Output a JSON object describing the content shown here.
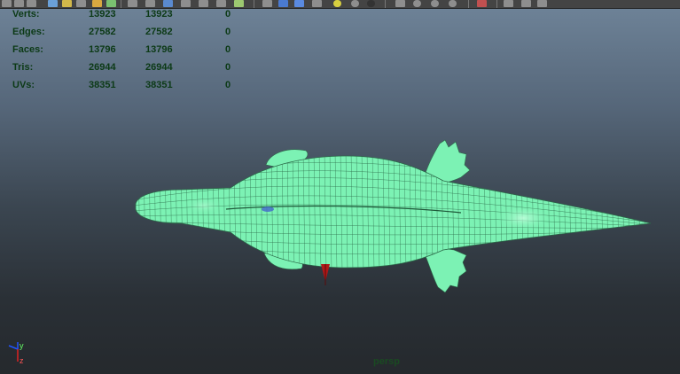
{
  "toolbar": {
    "icons": [
      "select-tool-icon",
      "lasso-tool-icon",
      "paint-tool-icon",
      "move-tool-icon",
      "rotate-tool-icon",
      "scale-tool-icon",
      "camera-icon",
      "grid-icon",
      "wireframe-icon",
      "smooth-shade-icon",
      "textured-icon",
      "lights-icon",
      "shadows-icon",
      "isolate-icon",
      "xray-icon",
      "cube-icon",
      "component-icon"
    ]
  },
  "hud": {
    "rows": [
      {
        "label": "Verts:",
        "v1": "13923",
        "v2": "13923",
        "v3": "0"
      },
      {
        "label": "Edges:",
        "v1": "27582",
        "v2": "27582",
        "v3": "0"
      },
      {
        "label": "Faces:",
        "v1": "13796",
        "v2": "13796",
        "v3": "0"
      },
      {
        "label": "Tris:",
        "v1": "26944",
        "v2": "26944",
        "v3": "0"
      },
      {
        "label": "UVs:",
        "v1": "38351",
        "v2": "38351",
        "v3": "0"
      }
    ]
  },
  "axis": {
    "y_label": "y",
    "z_label": "z"
  },
  "camera": {
    "label": "persp"
  },
  "colors": {
    "wireframe": "#7cf2b4",
    "wire_lines": "#2c6b49",
    "hud_text": "#0c3a16"
  }
}
